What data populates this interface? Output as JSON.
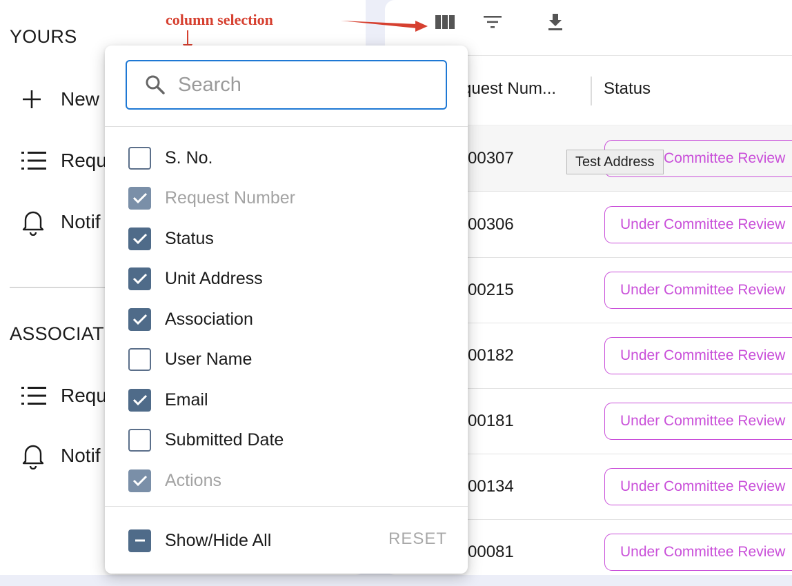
{
  "sidebar": {
    "sections": [
      {
        "title": "YOURS",
        "items": [
          {
            "icon": "plus-icon",
            "label": "New"
          },
          {
            "icon": "list-icon",
            "label": "Requ"
          },
          {
            "icon": "bell-icon",
            "label": "Notif"
          }
        ]
      },
      {
        "title": "ASSOCIAT",
        "items": [
          {
            "icon": "list-icon",
            "label": "Requ"
          },
          {
            "icon": "bell-icon",
            "label": "Notif"
          }
        ]
      }
    ]
  },
  "annotation": {
    "text": "column selection",
    "color": "#d64030"
  },
  "toolbar": {
    "icons": [
      "columns-icon",
      "filter-icon",
      "download-icon"
    ]
  },
  "table": {
    "columns": [
      "quest Num...",
      "Status"
    ],
    "rows": [
      {
        "number": "-00307",
        "status": "Under Committee Review"
      },
      {
        "number": "-00306",
        "status": "Under Committee Review"
      },
      {
        "number": "-00215",
        "status": "Under Committee Review"
      },
      {
        "number": "-00182",
        "status": "Under Committee Review"
      },
      {
        "number": "-00181",
        "status": "Under Committee Review"
      },
      {
        "number": "-00134",
        "status": "Under Committee Review"
      },
      {
        "number": "-00081",
        "status": "Under Committee Review"
      }
    ],
    "status_color": "#c94fd9"
  },
  "tooltip": "Test Address",
  "column_picker": {
    "search_placeholder": "Search",
    "options": [
      {
        "label": "S. No.",
        "checked": false,
        "disabled": false
      },
      {
        "label": "Request Number",
        "checked": true,
        "disabled": true
      },
      {
        "label": "Status",
        "checked": true,
        "disabled": false
      },
      {
        "label": "Unit Address",
        "checked": true,
        "disabled": false
      },
      {
        "label": "Association",
        "checked": true,
        "disabled": false
      },
      {
        "label": "User Name",
        "checked": false,
        "disabled": false
      },
      {
        "label": "Email",
        "checked": true,
        "disabled": false
      },
      {
        "label": "Submitted Date",
        "checked": false,
        "disabled": false
      },
      {
        "label": "Actions",
        "checked": true,
        "disabled": true
      }
    ],
    "show_hide_all": "Show/Hide All",
    "show_hide_all_state": "indeterminate",
    "reset": "RESET",
    "accent": "#1e78d4"
  }
}
